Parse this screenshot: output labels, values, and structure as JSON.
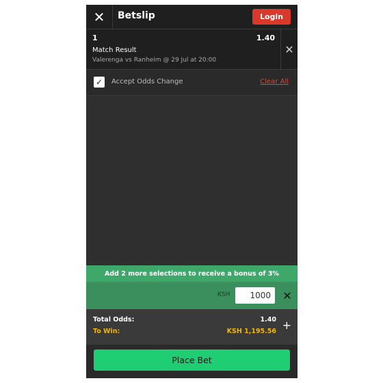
{
  "header": {
    "close_icon": "close-icon",
    "title": "Betslip",
    "login_label": "Login"
  },
  "selection": {
    "index": "1",
    "odds": "1.40",
    "market": "Match Result",
    "event": "Valerenga vs Ranheim @ 29 Jul at 20:00",
    "remove_icon": "close-icon"
  },
  "options": {
    "accept_odds_label": "Accept Odds Change",
    "accept_odds_checked": true,
    "clear_all_label": "Clear All"
  },
  "bonus": {
    "message": "Add 2 more selections to receive a bonus of 3%"
  },
  "stake": {
    "currency": "KSH",
    "value": "1000"
  },
  "totals": {
    "total_odds_label": "Total Odds:",
    "total_odds_value": "1.40",
    "to_win_label": "To Win:",
    "to_win_value": "KSH 1,195.56"
  },
  "footer": {
    "place_bet_label": "Place Bet"
  },
  "colors": {
    "login": "#d9382a",
    "clear_all": "#e3412f",
    "bonus_banner": "#3ea86b",
    "stake_row": "#3a8f5c",
    "to_win": "#f2b705",
    "place_bet": "#1fce73"
  }
}
